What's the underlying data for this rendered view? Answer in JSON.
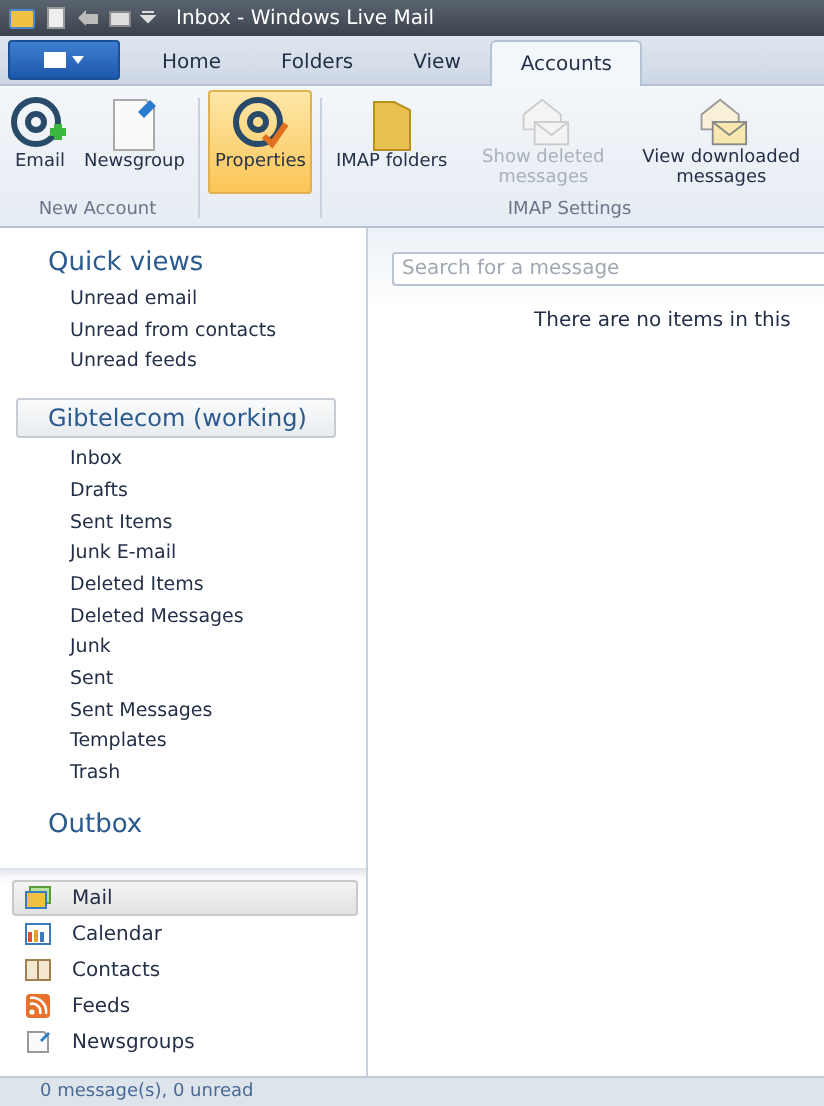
{
  "window": {
    "title": "Inbox - Windows Live Mail"
  },
  "tabs": [
    {
      "label": "Home",
      "selected": false
    },
    {
      "label": "Folders",
      "selected": false
    },
    {
      "label": "View",
      "selected": false
    },
    {
      "label": "Accounts",
      "selected": true
    }
  ],
  "ribbon_groups": [
    {
      "label": "New Account",
      "buttons": [
        {
          "kind": "email",
          "label": "Email",
          "selected": false,
          "disabled": false
        },
        {
          "kind": "newsgroup",
          "label": "Newsgroup",
          "selected": false,
          "disabled": false
        }
      ]
    },
    {
      "buttons": [
        {
          "kind": "properties",
          "label": "Properties",
          "selected": true,
          "disabled": false
        }
      ]
    },
    {
      "label": "IMAP Settings",
      "buttons": [
        {
          "kind": "folder",
          "label": "IMAP folders",
          "selected": false,
          "disabled": false
        },
        {
          "kind": "deleted",
          "label": "Show deleted messages",
          "selected": false,
          "disabled": true
        },
        {
          "kind": "downloaded",
          "label": "View downloaded messages",
          "selected": false,
          "disabled": false
        }
      ]
    }
  ],
  "quick_views": {
    "title": "Quick views",
    "items": [
      "Unread email",
      "Unread from contacts",
      "Unread feeds"
    ]
  },
  "account": {
    "name": "Gibtelecom (working)",
    "folders": [
      "Inbox",
      "Drafts",
      "Sent Items",
      "Junk E-mail",
      "Deleted Items",
      "Deleted Messages",
      "Junk",
      "Sent",
      "Sent Messages",
      "Templates",
      "Trash"
    ]
  },
  "outbox": "Outbox",
  "search": {
    "placeholder": "Search for a message"
  },
  "empty_message": "There are no items in this",
  "nav": [
    {
      "kind": "mail",
      "label": "Mail",
      "selected": true
    },
    {
      "kind": "calendar",
      "label": "Calendar",
      "selected": false
    },
    {
      "kind": "contacts",
      "label": "Contacts",
      "selected": false
    },
    {
      "kind": "feeds",
      "label": "Feeds",
      "selected": false
    },
    {
      "kind": "newsgroups",
      "label": "Newsgroups",
      "selected": false
    }
  ],
  "status_bar": "0 message(s), 0 unread"
}
